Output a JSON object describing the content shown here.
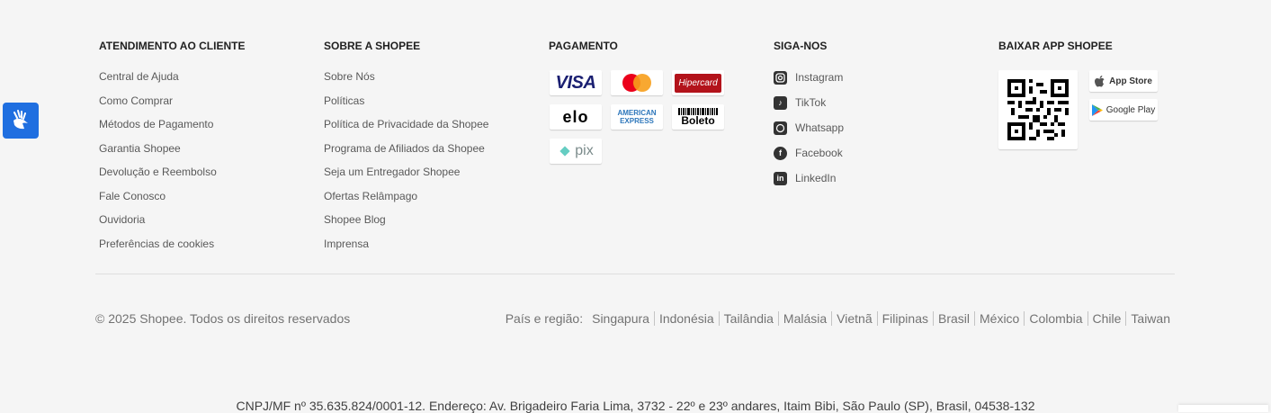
{
  "customer_service": {
    "title": "ATENDIMENTO AO CLIENTE",
    "links": [
      "Central de Ajuda",
      "Como Comprar",
      "Métodos de Pagamento",
      "Garantia Shopee",
      "Devolução e Reembolso",
      "Fale Conosco",
      "Ouvidoria",
      "Preferências de cookies"
    ]
  },
  "about": {
    "title": "SOBRE A SHOPEE",
    "links": [
      "Sobre Nós",
      "Políticas",
      "Política de Privacidade da Shopee",
      "Programa de Afiliados da Shopee",
      "Seja um Entregador Shopee",
      "Ofertas Relâmpago",
      "Shopee Blog",
      "Imprensa"
    ]
  },
  "payment": {
    "title": "PAGAMENTO",
    "methods": {
      "visa": "VISA",
      "hipercard": "Hipercard",
      "elo": "elo",
      "amex_1": "AMERICAN",
      "amex_2": "EXPRESS",
      "boleto": "Boleto",
      "pix": "pix"
    },
    "colors": {
      "visa": "#1a1f71",
      "hipercard": "#b3131b",
      "mastercard_red": "#eb001b",
      "mastercard_yellow": "#f79e1b",
      "amex": "#2e77bb",
      "pix": "#32bcad"
    }
  },
  "follow": {
    "title": "SIGA-NOS",
    "items": [
      "Instagram",
      "TikTok",
      "Whatsapp",
      "Facebook",
      "LinkedIn"
    ],
    "icons": [
      "instagram-icon",
      "tiktok-icon",
      "whatsapp-icon",
      "facebook-icon",
      "linkedin-icon"
    ]
  },
  "app": {
    "title": "BAIXAR APP SHOPEE",
    "app_store": "App Store",
    "google_play": "Google Play"
  },
  "bottom": {
    "copyright": "© 2025 Shopee. Todos os direitos reservados",
    "country_label": "País e região:",
    "countries": [
      "Singapura",
      "Indonésia",
      "Tailândia",
      "Malásia",
      "Vietnã",
      "Filipinas",
      "Brasil",
      "México",
      "Colombia",
      "Chile",
      "Taiwan"
    ],
    "legal": "CNPJ/MF nº 35.635.824/0001-12. Endereço: Av. Brigadeiro Faria Lima, 3732 - 22º e 23º andares, Itaim Bibi, São Paulo (SP), Brasil, 04538-132"
  },
  "accessibility": {
    "icon": "sign-language-icon",
    "color": "#1f6fe0"
  }
}
